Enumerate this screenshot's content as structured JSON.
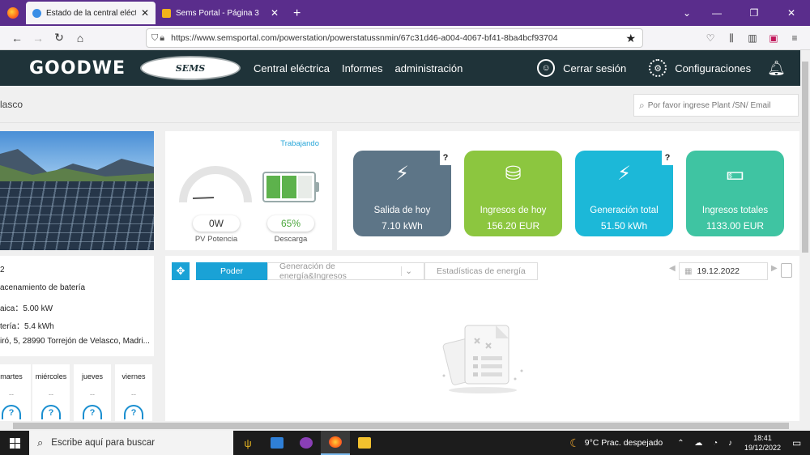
{
  "browser": {
    "tabs": [
      {
        "title": "Estado de la central eléctrica - SEMS Portal",
        "active": true
      },
      {
        "title": "Sems Portal - Página 3",
        "active": false
      }
    ],
    "url": "https://www.semsportal.com/powerstation/powerstatussnmin/67c31d46-a004-4067-bf41-8ba4bcf93704"
  },
  "header": {
    "logo": "GOODWE",
    "sems_logo": "SEMS",
    "nav": [
      "Central eléctrica",
      "Informes",
      "administración"
    ],
    "logout": "Cerrar sesión",
    "settings": "Configuraciones"
  },
  "subbar": {
    "plant_name": "lasco",
    "search_placeholder": "Por favor ingrese Plant /SN/ Email"
  },
  "status": {
    "state": "Trabajando",
    "pv_power_value": "0W",
    "pv_power_label": "PV Potencia",
    "battery_percent": 65,
    "battery_value": "65%",
    "battery_label": "Descarga"
  },
  "kpis": [
    {
      "label": "Salida de hoy",
      "value": "7.10 kWh",
      "color": "#5d7587",
      "icon": "bolt-icon",
      "help": "?"
    },
    {
      "label": "Ingresos de hoy",
      "value": "156.20 EUR",
      "color": "#8cc63f",
      "icon": "coins-icon",
      "help": ""
    },
    {
      "label": "Generación total",
      "value": "51.50 kWh",
      "color": "#1cb8d8",
      "icon": "bolt-icon",
      "help": "?"
    },
    {
      "label": "Ingresos totales",
      "value": "1133.00 EUR",
      "color": "#3fc4a2",
      "icon": "money-icon",
      "help": ""
    }
  ],
  "info": {
    "line1": "2",
    "line2": "acenamiento de batería",
    "line3_label": "aica：",
    "line3_value": "5.00 kW",
    "line4_label": "tería：",
    "line4_value": "5.4 kWh",
    "address": "iró, 5, 28990 Torrejón de Velasco, Madri..."
  },
  "weather": [
    {
      "day": "martes",
      "value": "--"
    },
    {
      "day": "miércoles",
      "value": "--"
    },
    {
      "day": "jueves",
      "value": "--"
    },
    {
      "day": "viernes",
      "value": "--"
    }
  ],
  "chart_panel": {
    "tabs": [
      "Poder",
      "Generación de energía&Ingresos",
      "Estadísticas de energía"
    ],
    "date": "19.12.2022"
  },
  "taskbar": {
    "search_placeholder": "Escribe aquí para buscar",
    "weather": "9°C  Prac. despejado",
    "time": "18:41",
    "date": "19/12/2022"
  }
}
